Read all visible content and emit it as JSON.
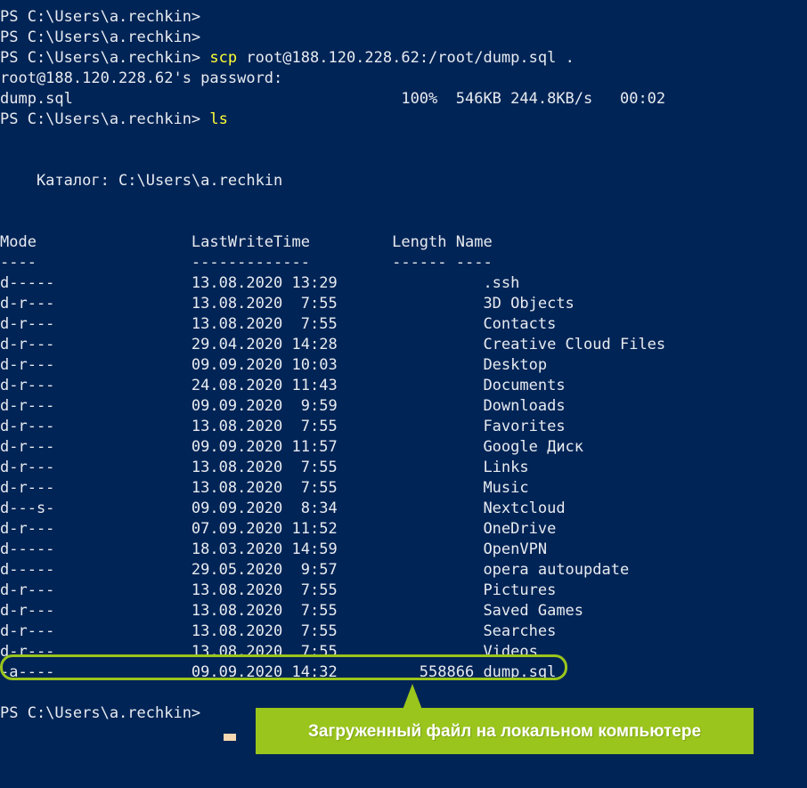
{
  "theme": {
    "background": "#012456",
    "foreground": "#e8ebf0",
    "command_color": "#ffff33",
    "accent_green": "#9ac51c",
    "cursor_color": "#f7d7b0"
  },
  "prompt": "PS C:\\Users\\a.rechkin>",
  "session": {
    "lines": [
      {
        "type": "prompt",
        "prompt": "PS C:\\Users\\a.rechkin>",
        "command": ""
      },
      {
        "type": "prompt",
        "prompt": "PS C:\\Users\\a.rechkin>",
        "command": ""
      },
      {
        "type": "prompt",
        "prompt": "PS C:\\Users\\a.rechkin>",
        "command": "scp",
        "args": " root@188.120.228.62:/root/dump.sql ."
      },
      {
        "type": "output",
        "text": "root@188.120.228.62's password:"
      },
      {
        "type": "output",
        "text": "dump.sql                                    100%  546KB 244.8KB/s   00:02"
      },
      {
        "type": "prompt",
        "prompt": "PS C:\\Users\\a.rechkin>",
        "command": "ls",
        "args": ""
      },
      {
        "type": "blank",
        "text": ""
      },
      {
        "type": "blank",
        "text": ""
      },
      {
        "type": "output",
        "text": "    Каталог: C:\\Users\\a.rechkin"
      },
      {
        "type": "blank",
        "text": ""
      },
      {
        "type": "blank",
        "text": ""
      },
      {
        "type": "output",
        "text": "Mode                 LastWriteTime         Length Name"
      },
      {
        "type": "output",
        "text": "----                 -------------         ------ ----"
      }
    ]
  },
  "transfer": {
    "filename": "dump.sql",
    "percent": "100%",
    "transferred": "546KB",
    "rate": "244.8KB/s",
    "elapsed": "00:02",
    "remote": "root@188.120.228.62:/root/dump.sql",
    "destination": ".",
    "password_prompt": "root@188.120.228.62's password:",
    "command": "scp"
  },
  "directory": {
    "label": "Каталог:",
    "path": "C:\\Users\\a.rechkin",
    "columns": [
      "Mode",
      "LastWriteTime",
      "Length",
      "Name"
    ],
    "column_rules": [
      "----",
      "-------------",
      "------",
      "----"
    ],
    "rows": [
      {
        "mode": "d-----",
        "date": "13.08.2020",
        "time": "13:29",
        "length": "",
        "name": ".ssh",
        "highlighted": false
      },
      {
        "mode": "d-r---",
        "date": "13.08.2020",
        "time": "7:55",
        "length": "",
        "name": "3D Objects",
        "highlighted": false
      },
      {
        "mode": "d-r---",
        "date": "13.08.2020",
        "time": "7:55",
        "length": "",
        "name": "Contacts",
        "highlighted": false
      },
      {
        "mode": "d-r---",
        "date": "29.04.2020",
        "time": "14:28",
        "length": "",
        "name": "Creative Cloud Files",
        "highlighted": false
      },
      {
        "mode": "d-r---",
        "date": "09.09.2020",
        "time": "10:03",
        "length": "",
        "name": "Desktop",
        "highlighted": false
      },
      {
        "mode": "d-r---",
        "date": "24.08.2020",
        "time": "11:43",
        "length": "",
        "name": "Documents",
        "highlighted": false
      },
      {
        "mode": "d-r---",
        "date": "09.09.2020",
        "time": "9:59",
        "length": "",
        "name": "Downloads",
        "highlighted": false
      },
      {
        "mode": "d-r---",
        "date": "13.08.2020",
        "time": "7:55",
        "length": "",
        "name": "Favorites",
        "highlighted": false
      },
      {
        "mode": "d-r---",
        "date": "09.09.2020",
        "time": "11:57",
        "length": "",
        "name": "Google Диск",
        "highlighted": false
      },
      {
        "mode": "d-r---",
        "date": "13.08.2020",
        "time": "7:55",
        "length": "",
        "name": "Links",
        "highlighted": false
      },
      {
        "mode": "d-r---",
        "date": "13.08.2020",
        "time": "7:55",
        "length": "",
        "name": "Music",
        "highlighted": false
      },
      {
        "mode": "d---s-",
        "date": "09.09.2020",
        "time": "8:34",
        "length": "",
        "name": "Nextcloud",
        "highlighted": false
      },
      {
        "mode": "d-r---",
        "date": "07.09.2020",
        "time": "11:52",
        "length": "",
        "name": "OneDrive",
        "highlighted": false
      },
      {
        "mode": "d-----",
        "date": "18.03.2020",
        "time": "14:59",
        "length": "",
        "name": "OpenVPN",
        "highlighted": false
      },
      {
        "mode": "d-----",
        "date": "29.05.2020",
        "time": "9:57",
        "length": "",
        "name": "opera autoupdate",
        "highlighted": false
      },
      {
        "mode": "d-r---",
        "date": "13.08.2020",
        "time": "7:55",
        "length": "",
        "name": "Pictures",
        "highlighted": false
      },
      {
        "mode": "d-r---",
        "date": "13.08.2020",
        "time": "7:55",
        "length": "",
        "name": "Saved Games",
        "highlighted": false
      },
      {
        "mode": "d-r---",
        "date": "13.08.2020",
        "time": "7:55",
        "length": "",
        "name": "Searches",
        "highlighted": false
      },
      {
        "mode": "d-r---",
        "date": "13.08.2020",
        "time": "7:55",
        "length": "",
        "name": "Videos",
        "highlighted": false
      },
      {
        "mode": "-a----",
        "date": "09.09.2020",
        "time": "14:32",
        "length": "558866",
        "name": "dump.sql",
        "highlighted": true
      }
    ]
  },
  "annotation": {
    "text": "Загруженный файл на локальном компьютере",
    "color": "#9ac51c",
    "text_color": "#ffffff"
  },
  "final_prompt": {
    "prompt": "PS C:\\Users\\a.rechkin>",
    "cursor": "block"
  }
}
